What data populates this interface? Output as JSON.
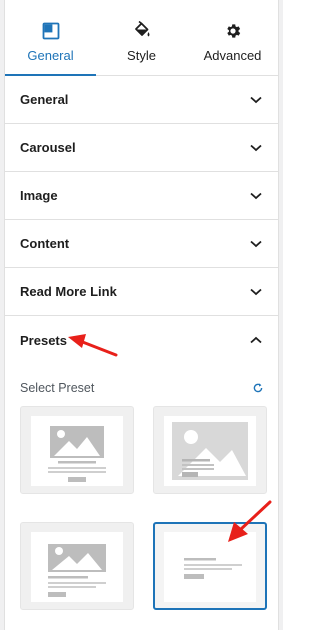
{
  "tabs": [
    {
      "label": "General",
      "icon": "layout-icon",
      "active": true
    },
    {
      "label": "Style",
      "icon": "paint-bucket-icon",
      "active": false
    },
    {
      "label": "Advanced",
      "icon": "gear-icon",
      "active": false
    }
  ],
  "sections": [
    {
      "label": "General",
      "expanded": false
    },
    {
      "label": "Carousel",
      "expanded": false
    },
    {
      "label": "Image",
      "expanded": false
    },
    {
      "label": "Content",
      "expanded": false
    },
    {
      "label": "Read More Link",
      "expanded": false
    },
    {
      "label": "Presets",
      "expanded": true
    }
  ],
  "presets": {
    "select_label": "Select Preset",
    "reset_icon": "reset-icon",
    "selected_index": 3,
    "items": [
      "preset-1",
      "preset-2",
      "preset-3",
      "preset-4"
    ]
  },
  "colors": {
    "accent": "#1e74b8",
    "annotation_arrow": "#e8201a"
  }
}
